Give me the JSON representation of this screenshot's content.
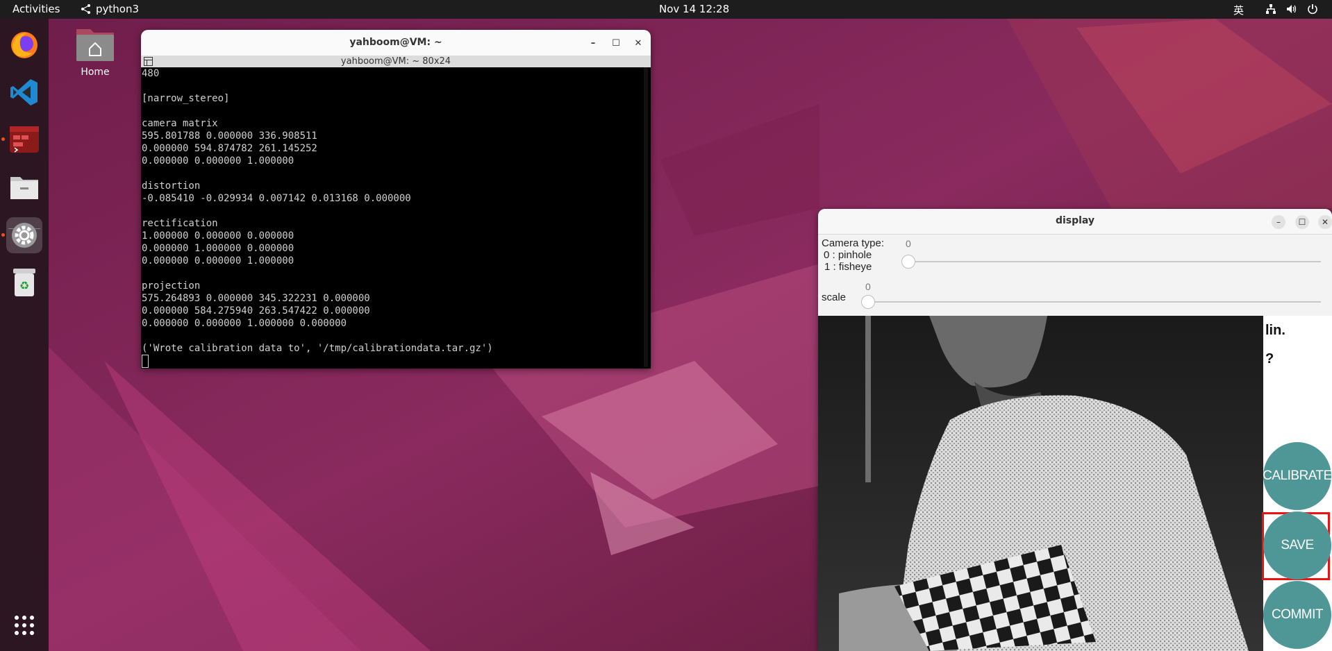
{
  "topbar": {
    "activities": "Activities",
    "app_name": "python3",
    "clock": "Nov 14  12:28",
    "input_method": "英"
  },
  "desktop": {
    "home_label": "Home"
  },
  "dock": {
    "items": [
      "firefox-icon",
      "vscode-icon",
      "terminal-icon",
      "files-icon",
      "settings-icon",
      "trash-icon",
      "show-apps-icon"
    ]
  },
  "terminal": {
    "title": "yahboom@VM: ~",
    "subtitle": "yahboom@VM: ~ 80x24",
    "lines": [
      "480",
      "",
      "[narrow_stereo]",
      "",
      "camera matrix",
      "595.801788 0.000000 336.908511",
      "0.000000 594.874782 261.145252",
      "0.000000 0.000000 1.000000",
      "",
      "distortion",
      "-0.085410 -0.029934 0.007142 0.013168 0.000000",
      "",
      "rectification",
      "1.000000 0.000000 0.000000",
      "0.000000 1.000000 0.000000",
      "0.000000 0.000000 1.000000",
      "",
      "projection",
      "575.264893 0.000000 345.322231 0.000000",
      "0.000000 584.275940 263.547422 0.000000",
      "0.000000 0.000000 1.000000 0.000000",
      "",
      "('Wrote calibration data to', '/tmp/calibrationdata.tar.gz')"
    ]
  },
  "display": {
    "title": "display",
    "camera_type_label": "Camera type:",
    "camera_type_value": "0",
    "option_pinhole": "0 : pinhole",
    "option_fisheye": "1 : fisheye",
    "scale_label": "scale",
    "scale_value": "0",
    "overlay_line1": "lin.",
    "overlay_line2": "?",
    "buttons": {
      "calibrate": "CALIBRATE",
      "save": "SAVE",
      "commit": "COMMIT"
    }
  }
}
